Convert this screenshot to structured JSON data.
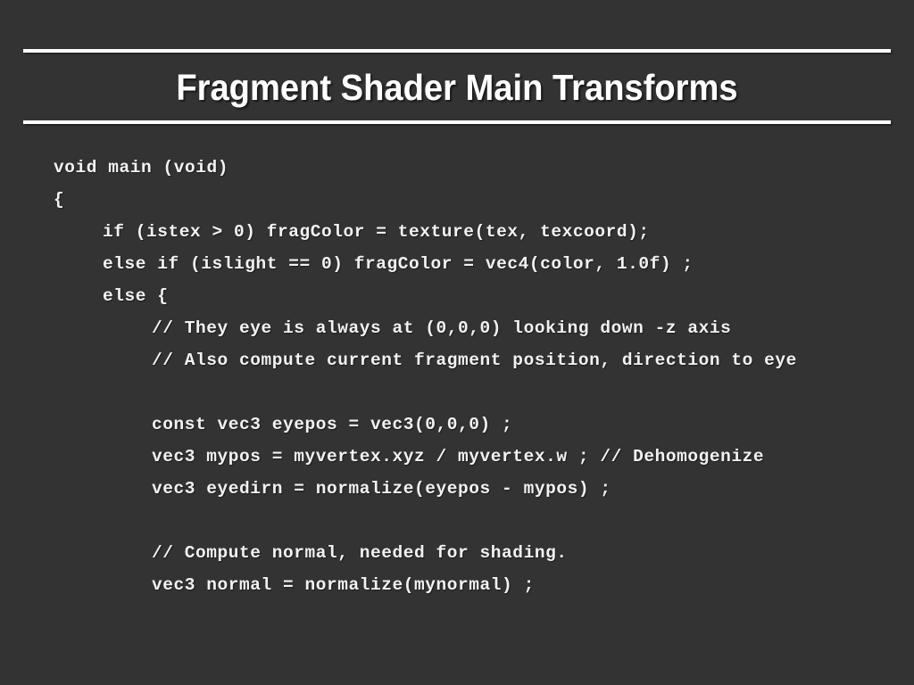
{
  "slide": {
    "title": "Fragment Shader Main Transforms",
    "background_color": "#333333",
    "text_color": "#f2f2f2",
    "rule_color": "#ffffff",
    "code_lines": [
      {
        "indent": 0,
        "text": "void main (void)"
      },
      {
        "indent": 0,
        "text": "{"
      },
      {
        "indent": 1,
        "text": "if (istex > 0) fragColor = texture(tex, texcoord);"
      },
      {
        "indent": 1,
        "text": "else if (islight == 0) fragColor = vec4(color, 1.0f) ;"
      },
      {
        "indent": 1,
        "text": "else {"
      },
      {
        "indent": 2,
        "text": "// They eye is always at (0,0,0) looking down -z axis"
      },
      {
        "indent": 2,
        "text": "// Also compute current fragment position, direction to eye"
      },
      {
        "indent": 2,
        "text": ""
      },
      {
        "indent": 2,
        "text": "const vec3 eyepos = vec3(0,0,0) ;"
      },
      {
        "indent": 2,
        "text": "vec3 mypos = myvertex.xyz / myvertex.w ; // Dehomogenize"
      },
      {
        "indent": 2,
        "text": "vec3 eyedirn = normalize(eyepos - mypos) ;"
      },
      {
        "indent": 2,
        "text": ""
      },
      {
        "indent": 2,
        "text": "// Compute normal, needed for shading."
      },
      {
        "indent": 2,
        "text": "vec3 normal = normalize(mynormal) ;"
      }
    ]
  }
}
